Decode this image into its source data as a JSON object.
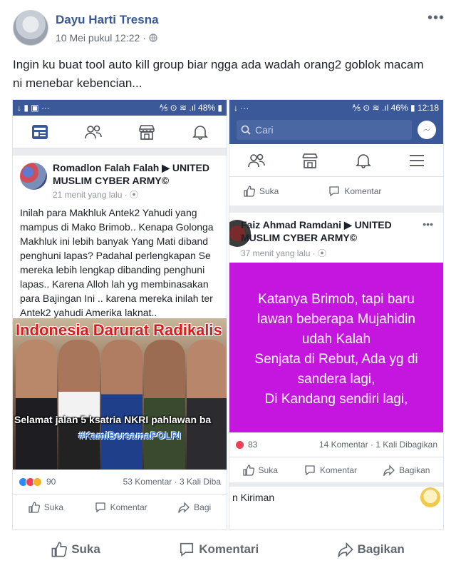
{
  "post": {
    "author": "Dayu Harti Tresna",
    "timestamp": "10 Mei pukul 12:22",
    "visibility_icon": "globe-icon",
    "more_label": "•••",
    "text_line1": "Ingin ku buat tool auto kill group biar ngga ada wadah orang2 goblok macam",
    "text_line2": "ni menebar kebencian..."
  },
  "left_screenshot": {
    "status_left": "↓ ▮ ▣ ···",
    "status_right": "⅍ ⊙ ≋ .ıl 48% ▮",
    "inner_author": "Romadlon Falah Falah ▶ UNITED MUSLIM CYBER ARMY©",
    "inner_time": "21 menit yang lalu · ⦿",
    "inner_text": [
      "Inilah para Makhluk Antek2 Yahudi yang",
      "mampus di Mako Brimob.. Kenapa Golonga",
      "Makhluk ini lebih banyak Yang Mati diband",
      "penghuni lapas? Padahal perlengkapan Se",
      "mereka lebih lengkap dibanding penghuni",
      "lapas.. Karena Alloh lah yg membinasakan",
      "para Bajingan Ini .. karena mereka inilah ter",
      "Antek2 yahudi Amerika laknat.."
    ],
    "photo_title": "Indonesia Darurat Radikalis",
    "photo_caption": "Selamat jalan 5 ksatria NKRI pahlawan ba",
    "photo_hashtag": "#KamiBersamaPOLRI",
    "reaction_count": "90",
    "comments_shares": "53 Komentar · 3 Kali Diba",
    "like_label": "Suka",
    "comment_label": "Komentar",
    "share_label": "Bagi"
  },
  "right_screenshot": {
    "status_left": "↓ ···",
    "status_right": "⅍ ⊙ ≋ .ıl 46% ▮ 12:18",
    "search_placeholder": "Cari",
    "top_like_label": "Suka",
    "top_comment_label": "Komentar",
    "inner_author": "Faiz Ahmad Ramdani ▶ UNITED MUSLIM CYBER ARMY©",
    "inner_time": "37 menit yang lalu · ⦿",
    "inner_more": "•••",
    "image_text": [
      "Katanya Brimob, tapi baru",
      "lawan beberapa Mujahidin",
      "udah Kalah",
      "Senjata di Rebut, Ada yg di",
      "sandera lagi,",
      "Di Kandang sendiri lagi,"
    ],
    "reaction_count": "83",
    "comments_shares": "14 Komentar · 1 Kali Dibagikan",
    "like_label": "Suka",
    "comment_label": "Komentar",
    "share_label": "Bagikan",
    "footer_label": "n Kiriman"
  },
  "outer_actions": {
    "like_label": "Suka",
    "comment_label": "Komentari",
    "share_label": "Bagikan"
  },
  "colors": {
    "fb_blue": "#3b5998",
    "link_blue": "#385898",
    "magenta": "#c516e0"
  }
}
